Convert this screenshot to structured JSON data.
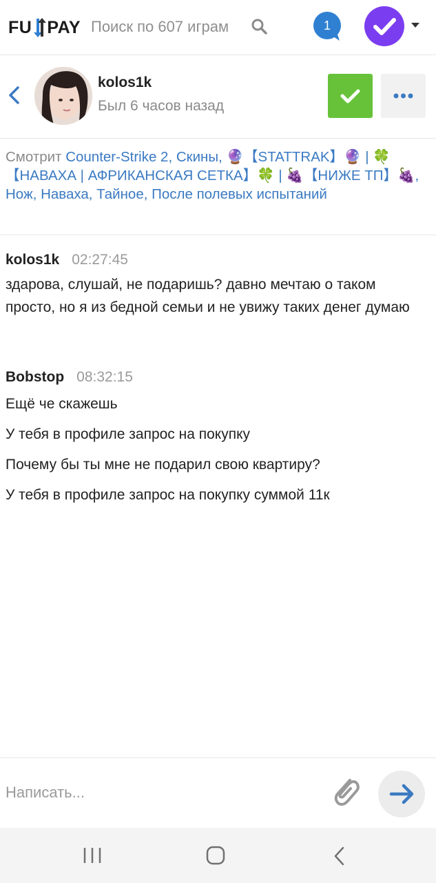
{
  "app": {
    "logo_text_left": "FU",
    "logo_text_right": "PAY",
    "search_placeholder": "Поиск по 607 играм",
    "notification_count": "1",
    "colors": {
      "accent": "#3a7ac2",
      "confirm": "#67c23a",
      "avatar": "#7b3df0",
      "badge": "#2f80d1"
    }
  },
  "contact": {
    "name": "kolos1k",
    "status": "Был 6 часов назад"
  },
  "watching": {
    "prefix": "Смотрит ",
    "link": "Counter-Strike 2, Скины, 🔮【STATTRAK】🔮 | 🍀【НАВАХА | АФРИКАНСКАЯ СЕТКА】🍀 | 🍇【НИЖЕ ТП】🍇, Нож, Наваха, Тайное, После полевых испытаний"
  },
  "messages": [
    {
      "author": "kolos1k",
      "time": "02:27:45",
      "lines": [
        "здарова, слушай, не подаришь? давно мечтаю о таком просто, но я из бедной семьи и не увижу таких денег думаю"
      ]
    },
    {
      "author": "Bobstop",
      "time": "08:32:15",
      "lines": [
        "Ещё че скажешь",
        "У тебя в профиле запрос на покупку",
        "Почему бы ты мне не подарил свою квартиру?",
        "У тебя в профиле запрос на покупку суммой 11к"
      ]
    }
  ],
  "composer": {
    "placeholder": "Написать..."
  },
  "icons": {
    "search": "search-icon",
    "back": "chevron-left-icon",
    "confirm": "check-icon",
    "more": "ellipsis-icon",
    "attach": "paperclip-icon",
    "send": "arrow-right-icon"
  }
}
